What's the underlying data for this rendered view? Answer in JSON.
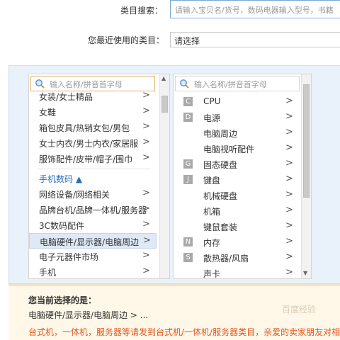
{
  "category_search": {
    "label": "类目搜索：",
    "placeholder": "请输入宝贝名/货号，数码电器输入型号，书籍"
  },
  "recent": {
    "label": "您最近使用的类目：",
    "value": "请选择"
  },
  "left_column": {
    "search_placeholder": "输入名称/拼音首字母",
    "items": [
      {
        "label": "女装/女士精品",
        "arrow": ">"
      },
      {
        "label": "女鞋",
        "arrow": ">"
      },
      {
        "label": "箱包皮具/热销女包/男包",
        "arrow": ">"
      },
      {
        "label": "女士内衣/男士内衣/家居服",
        "arrow": ">"
      },
      {
        "label": "服饰配件/皮带/帽子/围巾",
        "arrow": ">"
      },
      {
        "label": "手机数码 ▲",
        "arrow": ""
      },
      {
        "label": "网络设备/网络相关",
        "arrow": ">"
      },
      {
        "label": "品牌台机/品牌一体机/服务器",
        "arrow": ">"
      },
      {
        "label": "3C数码配件",
        "arrow": ">"
      },
      {
        "label": "电脑硬件/显示器/电脑周边",
        "arrow": ">"
      },
      {
        "label": "电子元器件市场",
        "arrow": ">"
      },
      {
        "label": "手机",
        "arrow": ">"
      }
    ]
  },
  "right_column": {
    "search_placeholder": "输入名称/拼音首字母",
    "items": [
      {
        "letter": "C",
        "label": "CPU",
        "arrow": ">"
      },
      {
        "letter": "D",
        "label": "电源",
        "arrow": ">"
      },
      {
        "letter": "",
        "label": "电脑周边",
        "arrow": ">"
      },
      {
        "letter": "",
        "label": "电脑视听配件",
        "arrow": ">"
      },
      {
        "letter": "G",
        "label": "固态硬盘",
        "arrow": ">"
      },
      {
        "letter": "J",
        "label": "键盘",
        "arrow": ">"
      },
      {
        "letter": "",
        "label": "机械硬盘",
        "arrow": ">"
      },
      {
        "letter": "",
        "label": "机箱",
        "arrow": ">"
      },
      {
        "letter": "",
        "label": "键鼠套装",
        "arrow": ">"
      },
      {
        "letter": "N",
        "label": "内存",
        "arrow": ">"
      },
      {
        "letter": "S",
        "label": "散热器/风扇",
        "arrow": ">"
      },
      {
        "letter": "",
        "label": "声卡",
        "arrow": ">"
      }
    ]
  },
  "selection": {
    "title": "您当前选择的是：",
    "path": "电脑硬件/显示器/电脑周边 > ...",
    "note": "台式机，一体机，服务器等请发到台式机/一体机/服务器类目，亲爱的卖家朋友对相",
    "watermark": "百度经验"
  },
  "colors": {
    "accent": "#2a6dc0",
    "panel_bg": "#e9f1fb",
    "note": "#e0581e",
    "bottom_bg": "#fff7e8"
  }
}
